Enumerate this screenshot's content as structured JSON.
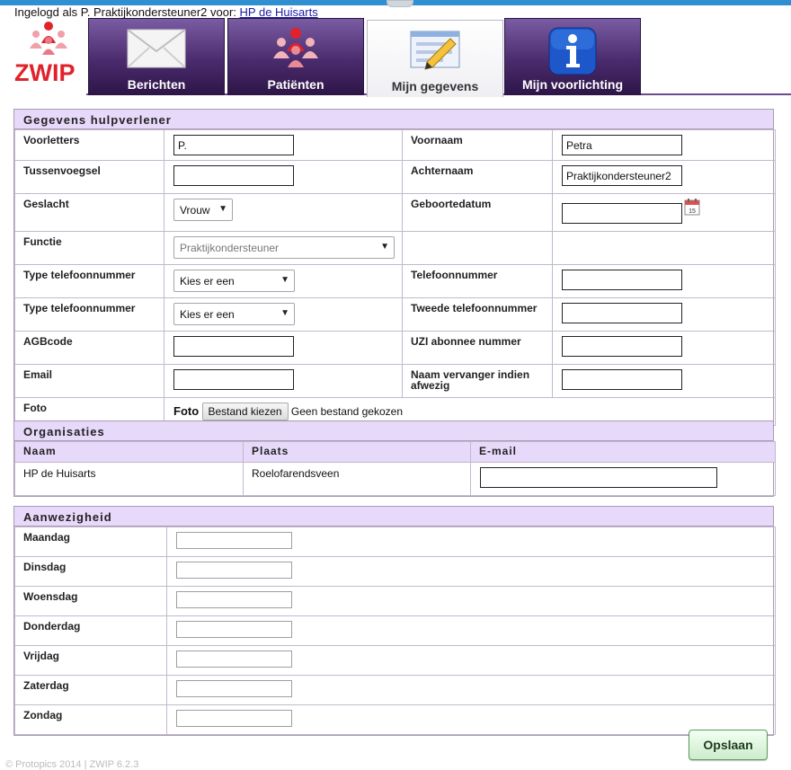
{
  "header": {
    "login_prefix": "Ingelogd als P. Praktijkondersteuner2 voor: ",
    "practice_link": "HP de Huisarts"
  },
  "logo": {
    "text": "ZWIP"
  },
  "tabs": [
    {
      "label": "Berichten",
      "icon": "envelope-icon",
      "active": false
    },
    {
      "label": "Patiënten",
      "icon": "people-icon",
      "active": false
    },
    {
      "label": "Mijn gegevens",
      "icon": "edit-form-icon",
      "active": true
    },
    {
      "label": "Mijn voorlichting",
      "icon": "info-icon",
      "active": false
    }
  ],
  "hulpverlener": {
    "title": "Gegevens hulpverlener",
    "voorletters_label": "Voorletters",
    "voorletters_value": "P.",
    "voornaam_label": "Voornaam",
    "voornaam_value": "Petra",
    "tussenvoegsel_label": "Tussenvoegsel",
    "tussenvoegsel_value": "",
    "achternaam_label": "Achternaam",
    "achternaam_value": "Praktijkondersteuner2",
    "geslacht_label": "Geslacht",
    "geslacht_value": "Vrouw",
    "geboortedatum_label": "Geboortedatum",
    "geboortedatum_value": "",
    "functie_label": "Functie",
    "functie_value": "Praktijkondersteuner",
    "type_tel1_label": "Type telefoonnummer",
    "type_tel1_value": "Kies er een",
    "telefoon_label": "Telefoonnummer",
    "telefoon_value": "",
    "type_tel2_label": "Type telefoonnummer",
    "type_tel2_value": "Kies er een",
    "tweede_tel_label": "Tweede telefoonnummer",
    "tweede_tel_value": "",
    "agb_label": "AGBcode",
    "agb_value": "",
    "uzi_label": "UZI abonnee nummer",
    "uzi_value": "",
    "email_label": "Email",
    "email_value": "",
    "vervanger_label": "Naam vervanger indien afwezig",
    "vervanger_value": "",
    "foto_label": "Foto",
    "foto_inline_label": "Foto",
    "file_button": "Bestand kiezen",
    "file_status": "Geen bestand gekozen"
  },
  "organisaties": {
    "title": "Organisaties",
    "columns": [
      "Naam",
      "Plaats",
      "E-mail"
    ],
    "rows": [
      {
        "naam": "HP de Huisarts",
        "plaats": "Roelofarendsveen",
        "email": ""
      }
    ]
  },
  "aanwezigheid": {
    "title": "Aanwezigheid",
    "days": [
      {
        "label": "Maandag",
        "value": ""
      },
      {
        "label": "Dinsdag",
        "value": ""
      },
      {
        "label": "Woensdag",
        "value": ""
      },
      {
        "label": "Donderdag",
        "value": ""
      },
      {
        "label": "Vrijdag",
        "value": ""
      },
      {
        "label": "Zaterdag",
        "value": ""
      },
      {
        "label": "Zondag",
        "value": ""
      }
    ]
  },
  "actions": {
    "save_label": "Opslaan"
  },
  "footer": {
    "text": "© Protopics 2014 | ZWIP 6.2.3"
  },
  "colors": {
    "tab_dark": "#2d1546",
    "tab_light": "#7a5ca3",
    "section_header": "#e7d9fa",
    "brand_red": "#e0222b",
    "save_green": "#cdeccd"
  }
}
